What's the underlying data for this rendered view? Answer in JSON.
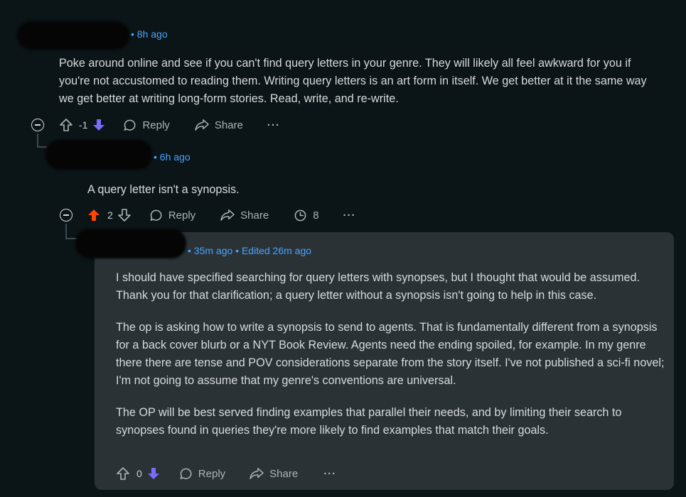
{
  "comments": [
    {
      "time": "• 8h ago",
      "paragraphs": [
        "Poke around online and see if you can't find query letters in your genre. They will likely all feel awkward for you if you're not accustomed to reading them. Writing query letters is an art form in itself. We get better at it the same way we get better at writing long-form stories. Read, write, and re-write."
      ],
      "score": "-1",
      "reply_label": "Reply",
      "share_label": "Share",
      "vote_state": "downvoted"
    },
    {
      "time": "• 6h ago",
      "paragraphs": [
        "A query letter isn't a synopsis."
      ],
      "score": "2",
      "reply_label": "Reply",
      "share_label": "Share",
      "award_count": "8",
      "vote_state": "upvoted"
    },
    {
      "time": "• 35m ago • Edited 26m ago",
      "paragraphs": [
        "I should have specified searching for query letters with synopses, but I thought that would be assumed. Thank you for that clarification; a query letter without a synopsis isn't going to help in this case.",
        "The op is asking how to write a synopsis to send to agents. That is fundamentally different from a synopsis for a back cover blurb or a NYT Book Review. Agents need the ending spoiled, for example. In my genre there there are tense and POV considerations separate from the story itself. I've not published a sci-fi novel; I'm not going to assume that my genre's conventions are universal.",
        "The OP will be best served finding examples that parallel their needs, and by limiting their search to synopses found in queries they're more likely to find examples that match their goals."
      ],
      "score": "0",
      "reply_label": "Reply",
      "share_label": "Share",
      "vote_state": "downvoted"
    }
  ],
  "colors": {
    "background": "#0b1416",
    "meta_link": "#4aa3ff",
    "upvote_active": "#ff4500",
    "downvote_active": "#7a6cff",
    "highlight_card": "#2a3236"
  }
}
